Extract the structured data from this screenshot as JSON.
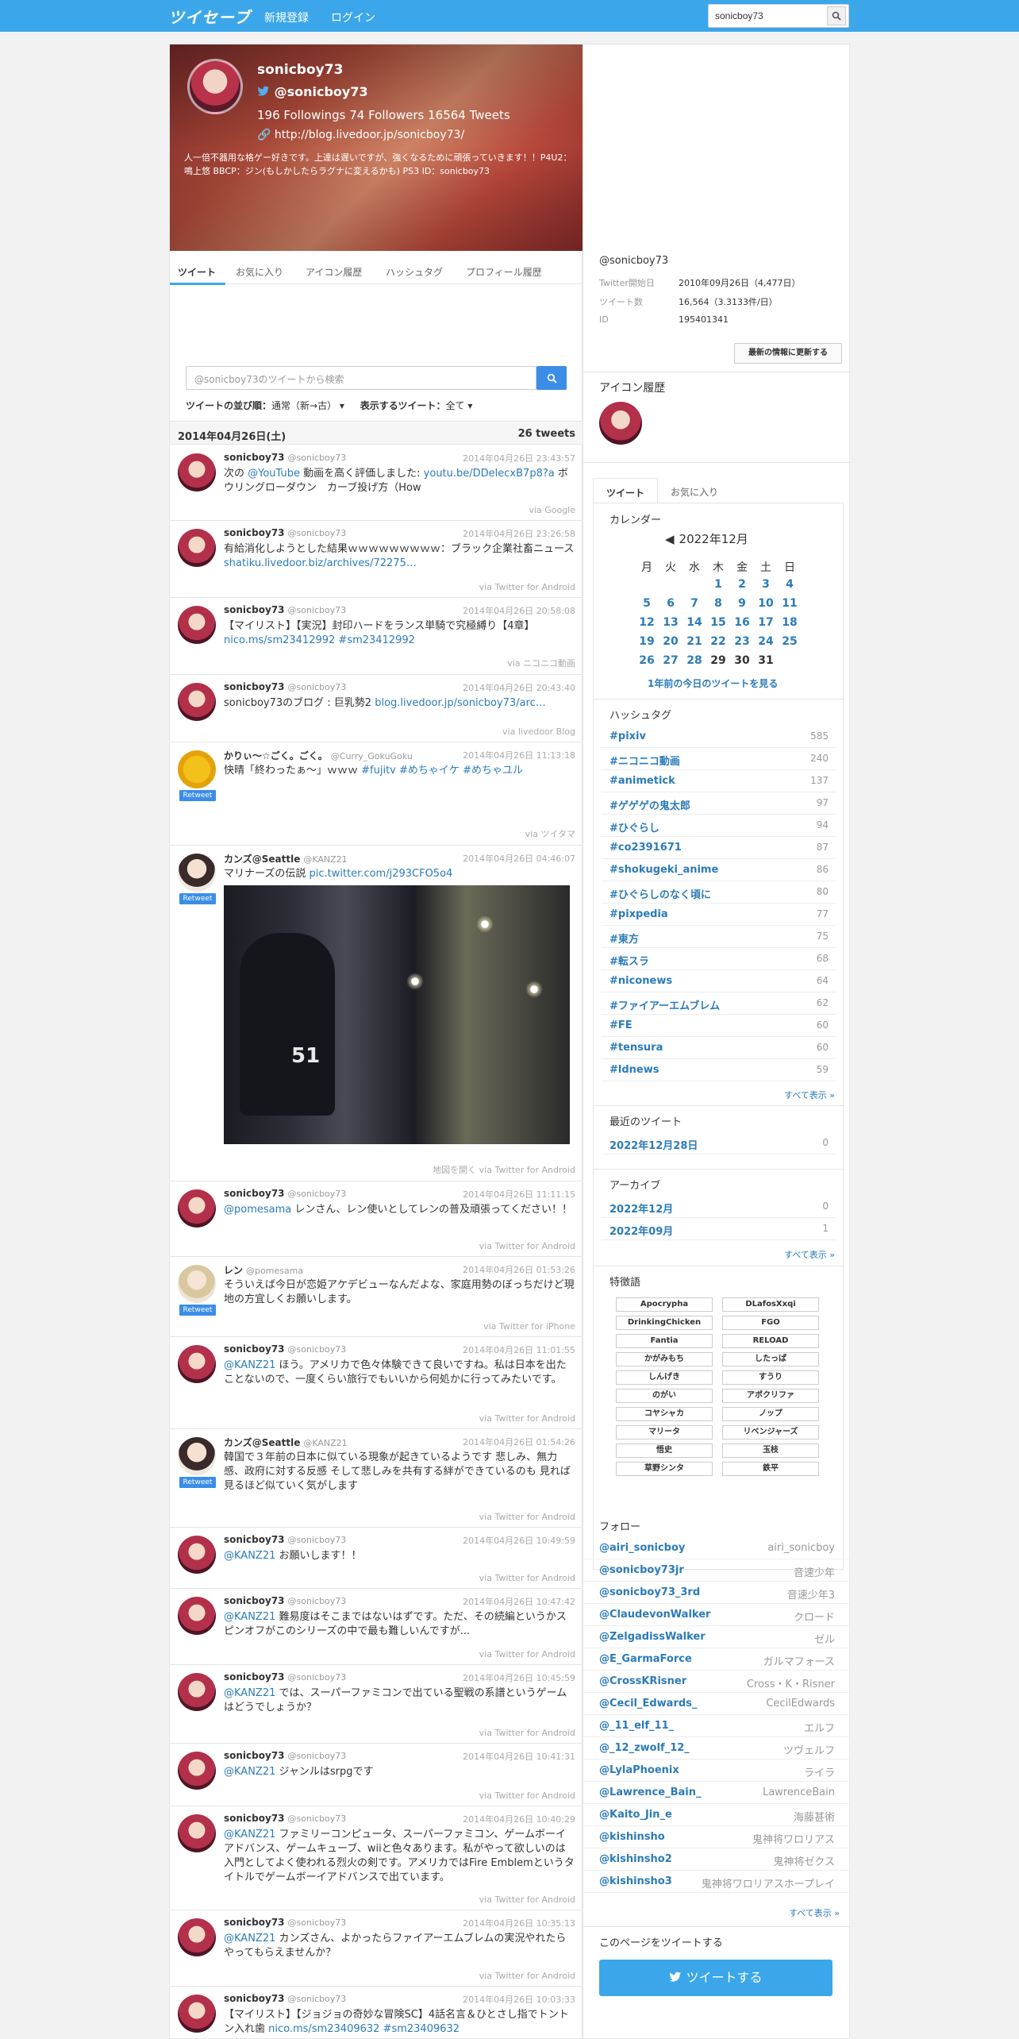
{
  "topbar": {
    "logo": "ツイセーブ",
    "nav": [
      "新規登録",
      "ログイン"
    ],
    "search_value": "sonicboy73"
  },
  "profile": {
    "name": "sonicboy73",
    "handle": "@sonicboy73",
    "stats": "196 Followings   74 Followers   16564 Tweets",
    "url": "http://blog.livedoor.jp/sonicboy73/",
    "bio": "人一倍不器用な格ゲー好きです。上達は遅いですが、強くなるために頑張っていきます！！P4U2：鳴上悠 BBCP：ジン(もしかしたらラグナに変えるかも) PS3 ID：sonicboy73"
  },
  "tabs": [
    "ツイート",
    "お気に入り",
    "アイコン履歴",
    "ハッシュタグ",
    "プロフィール履歴"
  ],
  "tweet_search": {
    "placeholder": "@sonicboy73のツイートから検索"
  },
  "sort": {
    "order_label": "ツイートの並び順：",
    "order_value": "通常（新→古）",
    "show_label": "表示するツイート：",
    "show_value": "全て"
  },
  "datebar": {
    "date": "2014年04月26日(土)",
    "count": "26 tweets"
  },
  "tweets": [
    {
      "name": "sonicboy73",
      "handle": "@sonicboy73",
      "time": "2014年04月26日 23:43:57",
      "text": "次の @YouTube 動画を高く評価しました: youtu.be/DDelecxB7p8?a ボウリングローダウン　カーブ投げ方（How",
      "via": "via Google"
    },
    {
      "name": "sonicboy73",
      "handle": "@sonicboy73",
      "time": "2014年04月26日 23:26:58",
      "text": "有給消化しようとした結果ｗｗｗｗｗｗｗｗｗ：ブラック企業社畜ニュース shatiku.livedoor.biz/archives/72275…",
      "via": "via Twitter for Android"
    },
    {
      "name": "sonicboy73",
      "handle": "@sonicboy73",
      "time": "2014年04月26日 20:58:08",
      "text": "【マイリスト】【実況】封印ハードをランス単騎で究極縛り【4章】 nico.ms/sm23412992 #sm23412992",
      "via": "via ニコニコ動画"
    },
    {
      "name": "sonicboy73",
      "handle": "@sonicboy73",
      "time": "2014年04月26日 20:43:40",
      "text": "sonicboy73のブログ : 巨乳勢2 blog.livedoor.jp/sonicboy73/arc…",
      "via": "via livedoor Blog"
    },
    {
      "name": "かりぃ～☆ごく。ごく。",
      "handle": "@Curry_GokuGoku",
      "time": "2014年04月26日 11:13:18",
      "text": "快晴「終わったぁ～」ｗｗｗ #fujitv #めちゃイケ #めちゃユル",
      "via": "via ツイタマ",
      "retweet": "Retweet"
    },
    {
      "name": "カンズ@Seattle",
      "handle": "@KANZ21",
      "time": "2014年04月26日 04:46:07",
      "text": "マリナーズの伝説 pic.twitter.com/j293CFO5o4",
      "via": "地図を開く  via Twitter for Android",
      "retweet": "Retweet",
      "photo_number": "51"
    },
    {
      "name": "sonicboy73",
      "handle": "@sonicboy73",
      "time": "2014年04月26日 11:11:15",
      "text": "@pomesama レンさん、レン使いとしてレンの普及頑張ってください！！",
      "via": "via Twitter for Android"
    },
    {
      "name": "レン",
      "handle": "@pomesama",
      "time": "2014年04月26日 01:53:26",
      "text": "そういえば今日が恋姫アケデビューなんだよな、家庭用勢のぼっちだけど現地の方宜しくお願いします。",
      "via": "via Twitter for iPhone",
      "retweet": "Retweet"
    },
    {
      "name": "sonicboy73",
      "handle": "@sonicboy73",
      "time": "2014年04月26日 11:01:55",
      "text": "@KANZ21 ほう。アメリカで色々体験できて良いですね。私は日本を出たことないので、一度くらい旅行でもいいから何処かに行ってみたいです。",
      "via": "via Twitter for Android"
    },
    {
      "name": "カンズ@Seattle",
      "handle": "@KANZ21",
      "time": "2014年04月26日 01:54:26",
      "text": "韓国で３年前の日本に似ている現象が起きているようです 悲しみ、無力感、政府に対する反感 そして悲しみを共有する絆ができているのも 見れば見るほど似ていく気がします",
      "via": "via Twitter for Android",
      "retweet": "Retweet"
    },
    {
      "name": "sonicboy73",
      "handle": "@sonicboy73",
      "time": "2014年04月26日 10:49:59",
      "text": "@KANZ21 お願いします！！",
      "via": "via Twitter for Android"
    },
    {
      "name": "sonicboy73",
      "handle": "@sonicboy73",
      "time": "2014年04月26日 10:47:42",
      "text": "@KANZ21 難易度はそこまではないはずです。ただ、その続編というかスピンオフがこのシリーズの中で最も難しいんですが...",
      "via": "via Twitter for Android"
    },
    {
      "name": "sonicboy73",
      "handle": "@sonicboy73",
      "time": "2014年04月26日 10:45:59",
      "text": "@KANZ21 では、スーパーファミコンで出ている聖戦の系譜というゲームはどうでしょうか？",
      "via": "via Twitter for Android"
    },
    {
      "name": "sonicboy73",
      "handle": "@sonicboy73",
      "time": "2014年04月26日 10:41:31",
      "text": "@KANZ21 ジャンルはsrpgです",
      "via": "via Twitter for Android"
    },
    {
      "name": "sonicboy73",
      "handle": "@sonicboy73",
      "time": "2014年04月26日 10:40:29",
      "text": "@KANZ21 ファミリーコンピュータ、スーパーファミコン、ゲームボーイアドバンス、ゲームキューブ、wiiと色々あります。私がやって欲しいのは入門としてよく使われる烈火の剣です。アメリカではFire Emblemというタイトルでゲームボーイアドバンスで出ています。",
      "via": "via Twitter for Android"
    },
    {
      "name": "sonicboy73",
      "handle": "@sonicboy73",
      "time": "2014年04月26日 10:35:13",
      "text": "@KANZ21 カンズさん、よかったらファイアーエムブレムの実況やれたらやってもらえませんか？",
      "via": "via Twitter for Android"
    },
    {
      "name": "sonicboy73",
      "handle": "@sonicboy73",
      "time": "2014年04月26日 10:03:33",
      "text": "【マイリスト】【ジョジョの奇妙な冒険SC】4話名言＆ひとさし指でトントン入れ歯 nico.ms/sm23409632 #sm23409632",
      "via": "via ニコニコ動画"
    }
  ],
  "side": {
    "handle": "@sonicboy73",
    "info": [
      {
        "label": "Twitter開始日",
        "value": "2010年09月26日（4,477日）"
      },
      {
        "label": "ツイート数",
        "value": "16,564（3.3133件/日）"
      },
      {
        "label": "ID",
        "value": "195401341"
      }
    ],
    "update_button": "最新の情報に更新する",
    "icon_history_title": "アイコン履歴",
    "panel_tabs": [
      "ツイート",
      "お気に入り"
    ],
    "calendar": {
      "title": "カレンダー",
      "month": "2022年12月",
      "weekdays": [
        "月",
        "火",
        "水",
        "木",
        "金",
        "土",
        "日"
      ],
      "rows": [
        [
          "",
          "",
          "",
          "1",
          "2",
          "3",
          "4"
        ],
        [
          "5",
          "6",
          "7",
          "8",
          "9",
          "10",
          "11"
        ],
        [
          "12",
          "13",
          "14",
          "15",
          "16",
          "17",
          "18"
        ],
        [
          "19",
          "20",
          "21",
          "22",
          "23",
          "24",
          "25"
        ],
        [
          "26",
          "27",
          "28",
          "29",
          "30",
          "31",
          ""
        ]
      ],
      "link": "1年前の今日のツイートを見る"
    },
    "hashtag_title": "ハッシュタグ",
    "hashtags": [
      {
        "tag": "#pixiv",
        "count": "585"
      },
      {
        "tag": "#ニコニコ動画",
        "count": "240"
      },
      {
        "tag": "#animetick",
        "count": "137"
      },
      {
        "tag": "#ゲゲゲの鬼太郎",
        "count": "97"
      },
      {
        "tag": "#ひぐらし",
        "count": "94"
      },
      {
        "tag": "#co2391671",
        "count": "87"
      },
      {
        "tag": "#shokugeki_anime",
        "count": "86"
      },
      {
        "tag": "#ひぐらしのなく頃に",
        "count": "80"
      },
      {
        "tag": "#pixpedia",
        "count": "77"
      },
      {
        "tag": "#東方",
        "count": "75"
      },
      {
        "tag": "#転スラ",
        "count": "68"
      },
      {
        "tag": "#niconews",
        "count": "64"
      },
      {
        "tag": "#ファイアーエムブレム",
        "count": "62"
      },
      {
        "tag": "#FE",
        "count": "60"
      },
      {
        "tag": "#tensura",
        "count": "60"
      },
      {
        "tag": "#ldnews",
        "count": "59"
      }
    ],
    "show_all": "すべて表示 »",
    "recent_title": "最近のツイート",
    "recent": [
      {
        "label": "2022年12月28日",
        "count": "0"
      }
    ],
    "archive_title": "アーカイブ",
    "archive": [
      {
        "label": "2022年12月",
        "count": "0"
      },
      {
        "label": "2022年09月",
        "count": "1"
      }
    ],
    "words_title": "特徴語",
    "words": [
      "Apocrypha",
      "DLafosXxqi",
      "DrinkingChicken",
      "FGO",
      "Fantia",
      "RELOAD",
      "かがみもち",
      "したっぱ",
      "しんげき",
      "すうり",
      "のがい",
      "アポクリファ",
      "コヤシャカ",
      "ノップ",
      "マリータ",
      "リベンジャーズ",
      "悟史",
      "玉枝",
      "草野シンタ",
      "鉄平"
    ],
    "follow_title": "フォロー",
    "follows": [
      {
        "handle": "@airi_sonicboy",
        "name": "airi_sonicboy"
      },
      {
        "handle": "@sonicboy73jr",
        "name": "音速少年"
      },
      {
        "handle": "@sonicboy73_3rd",
        "name": "音速少年3"
      },
      {
        "handle": "@ClaudevonWalker",
        "name": "クロード"
      },
      {
        "handle": "@ZelgadissWalker",
        "name": "ゼル"
      },
      {
        "handle": "@E_GarmaForce",
        "name": "ガルマフォース"
      },
      {
        "handle": "@CrossKRisner",
        "name": "Cross・K・Risner"
      },
      {
        "handle": "@Cecil_Edwards_",
        "name": "CecilEdwards"
      },
      {
        "handle": "@_11_elf_11_",
        "name": "エルフ"
      },
      {
        "handle": "@_12_zwolf_12_",
        "name": "ツヴェルフ"
      },
      {
        "handle": "@LylaPhoenix",
        "name": "ライラ"
      },
      {
        "handle": "@Lawrence_Bain_",
        "name": "LawrenceBain"
      },
      {
        "handle": "@Kaito_Jin_e",
        "name": "海藤甚術"
      },
      {
        "handle": "@kishinsho",
        "name": "鬼神将ワロリアス"
      },
      {
        "handle": "@kishinsho2",
        "name": "鬼神将ゼクス"
      },
      {
        "handle": "@kishinsho3",
        "name": "鬼神将ワロリアスホープレイ"
      }
    ],
    "share_title": "このページをツイートする",
    "tweet_button": "ツイートする"
  }
}
